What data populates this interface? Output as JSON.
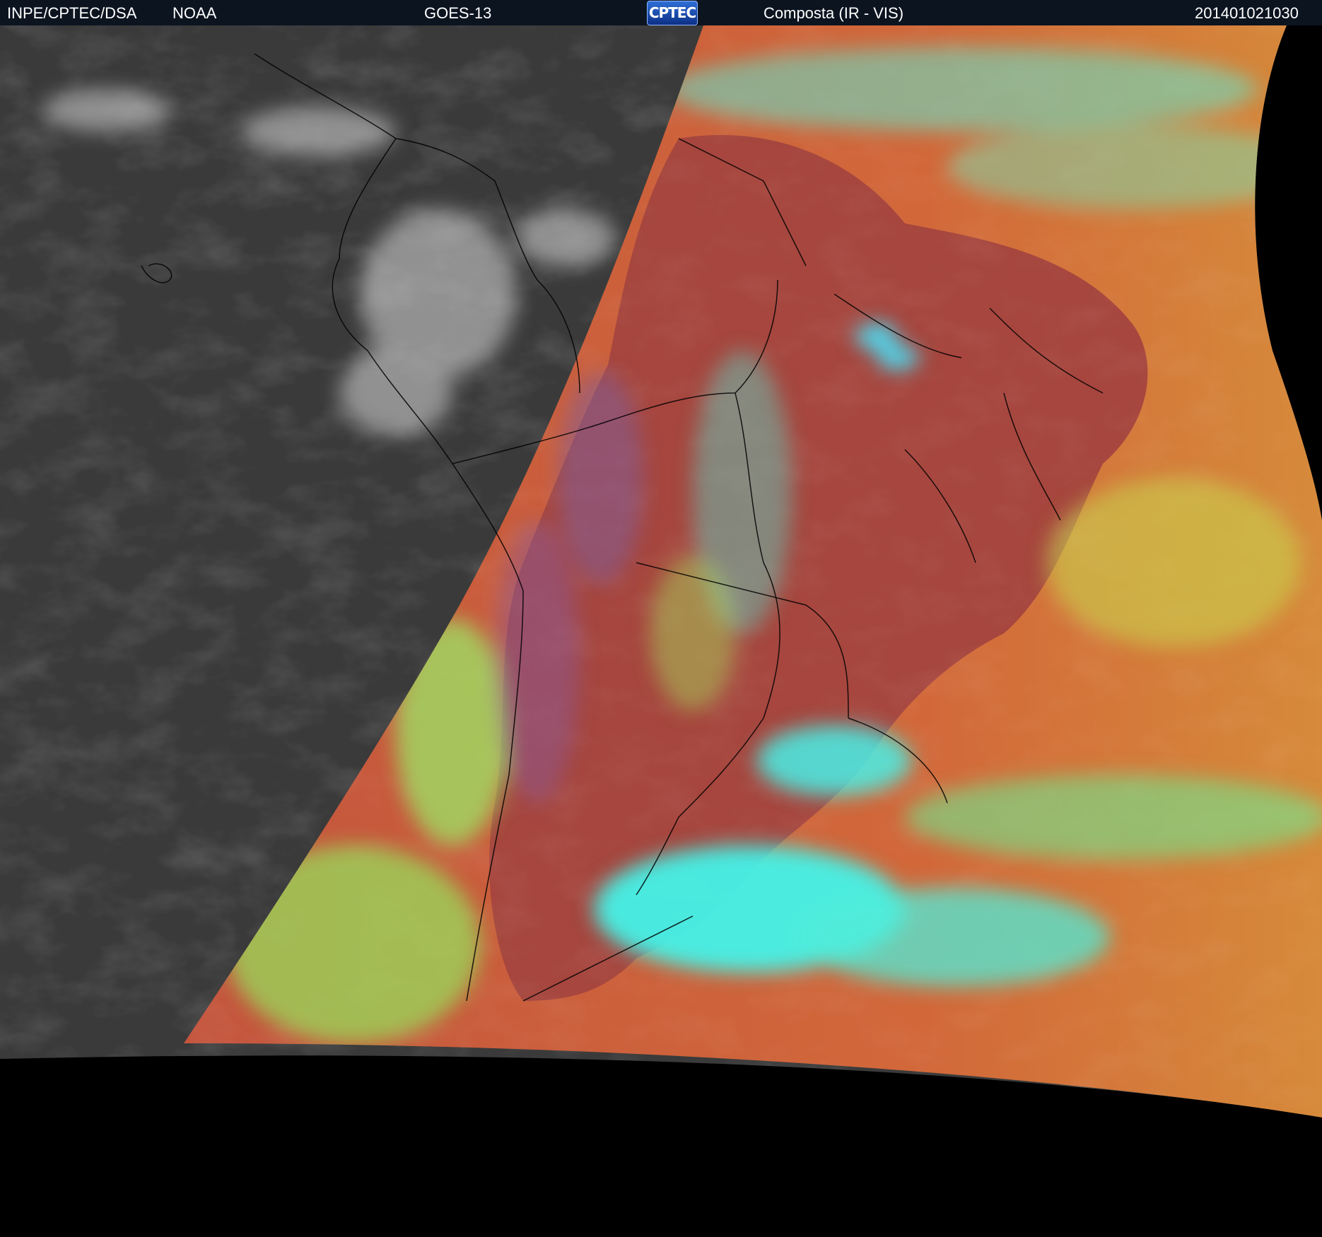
{
  "header": {
    "agency": "INPE/CPTEC/DSA",
    "source": "NOAA",
    "satellite": "GOES-13",
    "logo_text": "CPTEC",
    "product": "Composta (IR - VIS)",
    "timestamp": "201401021030"
  },
  "colors": {
    "header_bg": "#0c1420",
    "ir_gray": "#3c3c3c",
    "land_red": "#b04a42",
    "ocean_orange": "#d8703a",
    "cloud_cyan": "#40f0e0",
    "cloud_green": "#90f060",
    "outside_disk": "#000000",
    "borders": "#000000"
  }
}
